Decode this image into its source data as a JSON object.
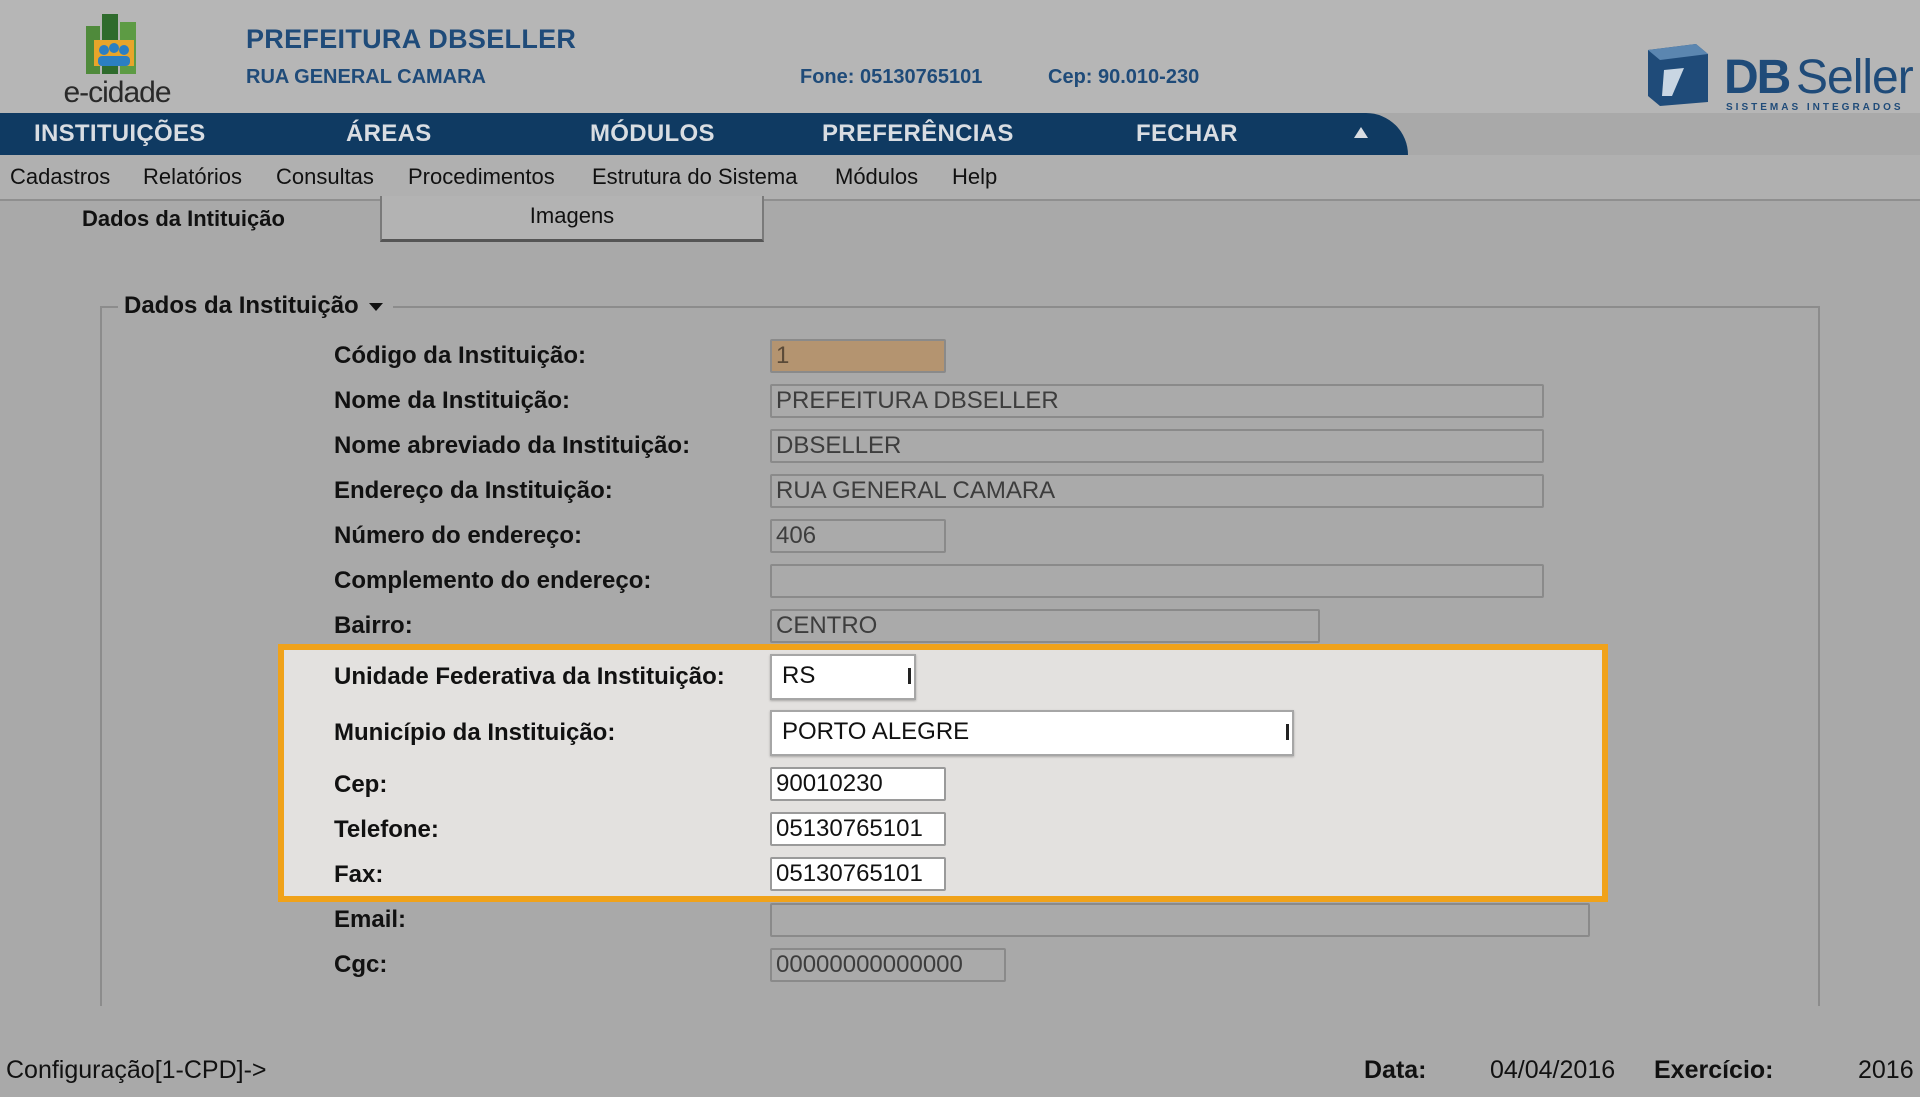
{
  "header": {
    "logo_text": "e-cidade",
    "org_name": "PREFEITURA DBSELLER",
    "org_street": "RUA GENERAL CAMARA",
    "phone": "Fone: 05130765101",
    "cep": "Cep: 90.010-230",
    "vendor_logo_bold": "DB",
    "vendor_logo_light": "Seller",
    "vendor_tagline": "SISTEMAS INTEGRADOS"
  },
  "main_menu": [
    "INSTITUIÇÕES",
    "ÁREAS",
    "MÓDULOS",
    "PREFERÊNCIAS",
    "FECHAR"
  ],
  "sub_menu": [
    "Cadastros",
    "Relatórios",
    "Consultas",
    "Procedimentos",
    "Estrutura do Sistema",
    "Módulos",
    "Help"
  ],
  "tabs": {
    "active": "Dados da Intituição",
    "other": "Imagens"
  },
  "fieldset": {
    "legend": "Dados da Instituição",
    "fields": {
      "codigo": {
        "label": "Código da Instituição:",
        "value": "1"
      },
      "nome": {
        "label": "Nome da Instituição:",
        "value": "PREFEITURA DBSELLER"
      },
      "nome_abreviado": {
        "label": "Nome abreviado da Instituição:",
        "value": "DBSELLER"
      },
      "endereco": {
        "label": "Endereço da Instituição:",
        "value": "RUA GENERAL CAMARA"
      },
      "numero": {
        "label": "Número do endereço:",
        "value": "406"
      },
      "complemento": {
        "label": "Complemento do endereço:",
        "value": ""
      },
      "bairro": {
        "label": "Bairro:",
        "value": "CENTRO"
      },
      "uf": {
        "label": "Unidade Federativa da Instituição:",
        "value": "RS"
      },
      "municipio": {
        "label": "Município da Instituição:",
        "value": "PORTO ALEGRE"
      },
      "cep": {
        "label": "Cep:",
        "value": "90010230"
      },
      "telefone": {
        "label": "Telefone:",
        "value": "05130765101"
      },
      "fax": {
        "label": "Fax:",
        "value": "05130765101"
      },
      "email": {
        "label": "Email:",
        "value": ""
      },
      "cgc": {
        "label": "Cgc:",
        "value": "00000000000000"
      }
    }
  },
  "footer": {
    "context": "Configuração[1-CPD]->",
    "data_label": "Data:",
    "data_value": "04/04/2016",
    "exercicio_label": "Exercício:",
    "exercicio_value": "2016"
  },
  "colors": {
    "nav_bar": "#0f3a62",
    "brand_blue": "#1f4b79",
    "highlight": "#f0a21a",
    "background": "#a9a9a9"
  }
}
